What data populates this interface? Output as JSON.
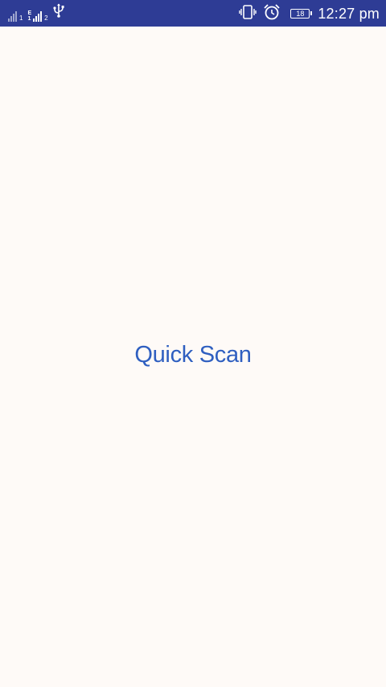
{
  "status_bar": {
    "background": "#2e3c95",
    "sim1_index": "1",
    "network_type_top": "E",
    "network_type_bottom": "1",
    "sim2_index": "2",
    "battery_level": "18",
    "time": "12:27 pm",
    "icons": [
      "signal-icon",
      "signal-icon",
      "usb-icon",
      "vibrate-icon",
      "alarm-icon",
      "battery-icon"
    ]
  },
  "main": {
    "title": "Quick Scan",
    "title_color": "#2f5fc0",
    "background": "#fefaf7"
  }
}
